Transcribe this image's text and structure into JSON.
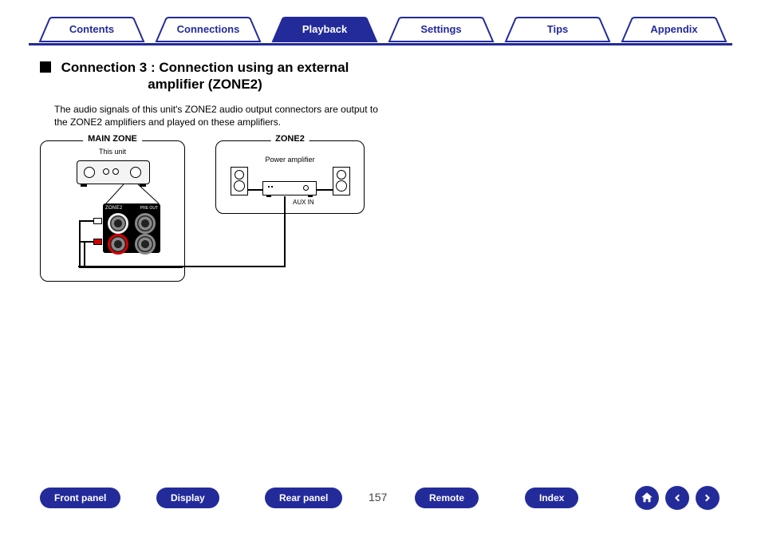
{
  "tabs": {
    "items": [
      {
        "label": "Contents"
      },
      {
        "label": "Connections"
      },
      {
        "label": "Playback"
      },
      {
        "label": "Settings"
      },
      {
        "label": "Tips"
      },
      {
        "label": "Appendix"
      }
    ],
    "active_index": 2
  },
  "heading": "Connection 3 : Connection using an external amplifier (ZONE2)",
  "body": "The audio signals of this unit's ZONE2 audio output connectors are output to the ZONE2 amplifiers and played on these amplifiers.",
  "diagram": {
    "main_zone_label": "MAIN ZONE",
    "zone2_label": "ZONE2",
    "this_unit": "This unit",
    "power_amp": "Power amplifier",
    "aux_in": "AUX IN",
    "rear_tag": "ZONE2",
    "preout_tag": "PRE OUT"
  },
  "bottom": {
    "buttons": [
      {
        "label": "Front panel"
      },
      {
        "label": "Display"
      },
      {
        "label": "Rear panel"
      },
      {
        "label": "Remote"
      },
      {
        "label": "Index"
      }
    ],
    "page": "157"
  },
  "nav_icons": {
    "home": "home-icon",
    "prev": "arrow-left-icon",
    "next": "arrow-right-icon"
  }
}
